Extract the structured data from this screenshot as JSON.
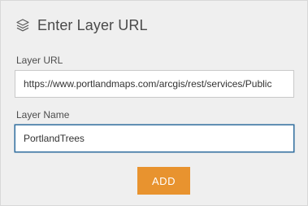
{
  "dialog": {
    "title": "Enter Layer URL",
    "icon": "layers-icon"
  },
  "layer_url": {
    "label": "Layer URL",
    "value": "https://www.portlandmaps.com/arcgis/rest/services/Public"
  },
  "layer_name": {
    "label": "Layer Name",
    "value": "PortlandTrees"
  },
  "actions": {
    "add_label": "ADD",
    "add_color": "#e8932f"
  },
  "colors": {
    "panel_background": "#efefef",
    "focus_border": "#2f6d9e"
  }
}
